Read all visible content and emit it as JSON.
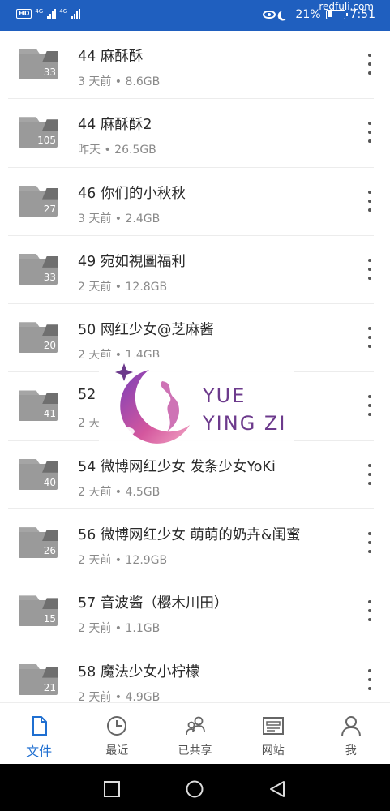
{
  "status_bar": {
    "hd": "HD",
    "network_1": "4G",
    "network_2": "4G",
    "battery": "21%",
    "time": "7:51",
    "watermark": "redfuli.com"
  },
  "files": [
    {
      "name": "44 麻酥酥",
      "meta": "3 天前 • 8.6GB",
      "count": "33"
    },
    {
      "name": "44 麻酥酥2",
      "meta": "昨天 • 26.5GB",
      "count": "105"
    },
    {
      "name": "46 你们的小秋秋",
      "meta": "3 天前 • 2.4GB",
      "count": "27"
    },
    {
      "name": "49 宛如視圖福利",
      "meta": "2 天前 • 12.8GB",
      "count": "33"
    },
    {
      "name": "50 网红少女@芝麻酱",
      "meta": "2 天前 • 1.4GB",
      "count": "20"
    },
    {
      "name": "52",
      "meta": "2 天",
      "count": "41"
    },
    {
      "name": "54 微博网红少女 发条少女YoKi",
      "meta": "2 天前 • 4.5GB",
      "count": "40"
    },
    {
      "name": "56 微博网红少女 萌萌的奶卉&闺蜜",
      "meta": "2 天前 • 12.9GB",
      "count": "26"
    },
    {
      "name": "57 音波酱（樱木川田）",
      "meta": "2 天前 • 1.1GB",
      "count": "15"
    },
    {
      "name": "58 魔法少女小柠檬",
      "meta": "2 天前 • 4.9GB",
      "count": "21"
    }
  ],
  "overlay": {
    "line1": "YUE",
    "line2": "YING ZI"
  },
  "nav": {
    "files": "文件",
    "recent": "最近",
    "shared": "已共享",
    "sites": "网站",
    "me": "我"
  },
  "colors": {
    "status_bar": "#1f5fbf",
    "accent": "#1f6fd1",
    "folder": "#9a9a9a",
    "logo_purple": "#6c3a8c"
  }
}
